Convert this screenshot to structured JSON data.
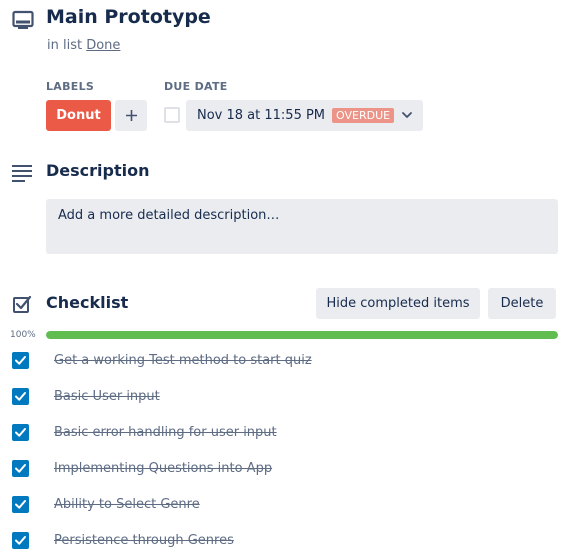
{
  "card": {
    "title": "Main Prototype",
    "in_list_prefix": "in list",
    "list_name": "Done"
  },
  "labels": {
    "heading": "LABELS",
    "items": [
      {
        "text": "Donut",
        "color": "#eb5a46"
      }
    ],
    "add_symbol": "+"
  },
  "due_date": {
    "heading": "DUE DATE",
    "value": "Nov 18 at 11:55 PM",
    "badge": "OVERDUE",
    "badge_color": "#ec9488",
    "completed": false
  },
  "description": {
    "title": "Description",
    "placeholder": "Add a more detailed description…"
  },
  "checklist": {
    "title": "Checklist",
    "hide_completed_label": "Hide completed items",
    "delete_label": "Delete",
    "progress_text": "100%",
    "progress_fraction": 1.0,
    "progress_color": "#61bd4f",
    "items": [
      {
        "text": "Get a working Test method to start quiz",
        "checked": true
      },
      {
        "text": "Basic User input",
        "checked": true
      },
      {
        "text": "Basic error handling for user input",
        "checked": true
      },
      {
        "text": "Implementing Questions into App",
        "checked": true
      },
      {
        "text": "Ability to Select Genre",
        "checked": true
      },
      {
        "text": "Persistence through Genres",
        "checked": true
      }
    ]
  },
  "icons": {
    "card": "card-icon",
    "description": "description-icon",
    "checklist": "checklist-icon",
    "add": "plus-icon",
    "dropdown": "chevron-down-icon",
    "checkmark": "checkmark-icon"
  },
  "colors": {
    "text": "#172b4d",
    "muted": "#5e6c84",
    "button_bg": "#ebecf0",
    "checkbox_blue": "#0079bf"
  }
}
